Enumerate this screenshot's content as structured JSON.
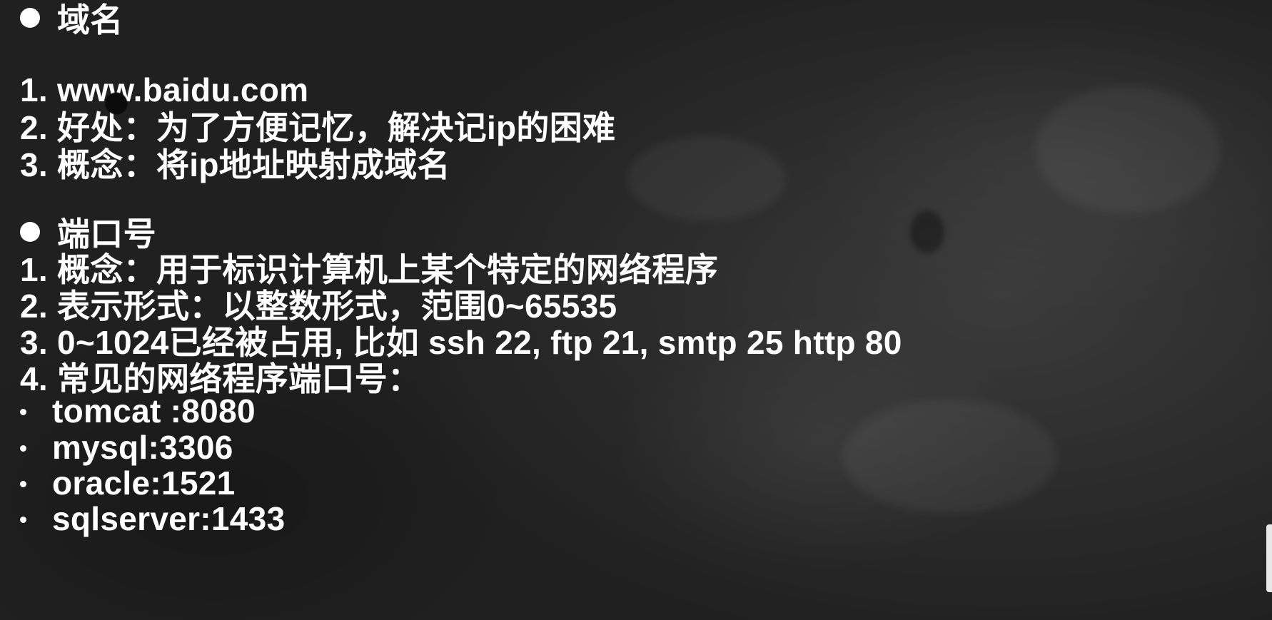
{
  "domain_section": {
    "heading": "域名",
    "items": [
      "1. www.baidu.com",
      "2. 好处：为了方便记忆，解决记ip的困难",
      "3. 概念：将ip地址映射成域名"
    ]
  },
  "port_section": {
    "heading": "端口号",
    "items": [
      "1. 概念：用于标识计算机上某个特定的网络程序",
      "2. 表示形式：以整数形式，范围0~65535",
      "3. 0~1024已经被占用, 比如 ssh 22, ftp 21, smtp 25  http 80",
      "4. 常见的网络程序端口号："
    ],
    "common_ports": [
      "tomcat :8080",
      "mysql:3306",
      "oracle:1521",
      "sqlserver:1433"
    ]
  },
  "colors": {
    "background": "#2b2b2b",
    "text": "#ffffff",
    "cursor_highlight": "#3cb878"
  }
}
